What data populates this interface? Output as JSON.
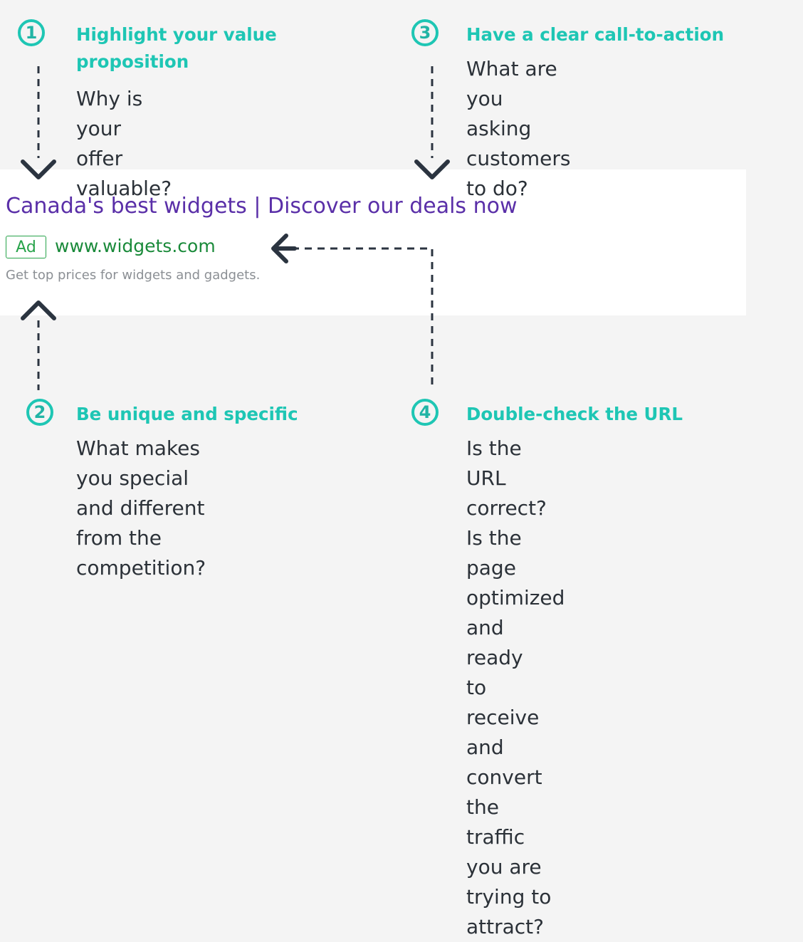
{
  "steps": [
    {
      "number": "1",
      "title_lines": [
        "Highlight your value",
        "proposition"
      ],
      "description": [
        "Why is your offer valuable?"
      ]
    },
    {
      "number": "2",
      "title_lines": [
        "Be unique and specific"
      ],
      "description": [
        "What makes you special",
        "and different from the",
        "competition?"
      ]
    },
    {
      "number": "3",
      "title_lines": [
        "Have a clear call-to-action"
      ],
      "description": [
        "What are you asking",
        "customers to do?"
      ]
    },
    {
      "number": "4",
      "title_lines": [
        "Double-check the URL"
      ],
      "description": [
        "Is the URL correct? Is the",
        "page optimized and ready",
        "to receive and convert the",
        "traffic you are trying to",
        "attract?"
      ]
    }
  ],
  "ad": {
    "headline": "Canada's best widgets | Discover our deals now",
    "label": "Ad",
    "url": "www.widgets.com",
    "description": "Get top prices for widgets and gadgets."
  },
  "colors": {
    "accent": "#1ec6b4",
    "headline": "#5a2fa8",
    "url": "#1a8a3a",
    "ad_desc": "#8b8f94",
    "text": "#2b3138",
    "arrow": "#2b3440",
    "background": "#f4f4f4"
  },
  "icons": [
    "arrow-down-icon",
    "arrow-up-icon",
    "arrow-left-icon"
  ]
}
